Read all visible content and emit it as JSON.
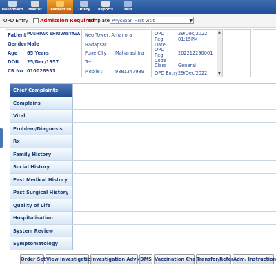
{
  "toolbar": {
    "items": [
      {
        "label": "Dashboard",
        "icon": "dashboard-icon"
      },
      {
        "label": "Master",
        "icon": "master-icon"
      },
      {
        "label": "Transaction",
        "icon": "transaction-icon"
      },
      {
        "label": "Utility",
        "icon": "utility-icon"
      },
      {
        "label": "Reports",
        "icon": "reports-icon"
      },
      {
        "label": "Help",
        "icon": "help-icon"
      }
    ],
    "active": "Transaction"
  },
  "entry": {
    "title": "OPD Entry",
    "admission_label": "Admission Required",
    "template_label": "Template:",
    "template_value": "Physician First Visit"
  },
  "patient": {
    "name_label": "Patient",
    "name_value": "PUSHPAK SHRIVASTAVA",
    "gender_label": "Gender",
    "gender_value": "Male",
    "age_label": "Age",
    "age_value": "65 Years",
    "dob_label": "DOB",
    "dob_value": "25/Dec/1957",
    "crno_label": "CR No",
    "crno_value": "010028931"
  },
  "address": {
    "line1": "Neo Tower, Amanora",
    "line2": "Hadapsar",
    "city_label": "Pune City",
    "state": "Maharashtra",
    "tel_label": "Tel :",
    "mobile_label": "Mobile :",
    "mobile_value": "9881347989"
  },
  "opd": {
    "reg_date_label": "OPD Reg. Date",
    "reg_date_value": "29/Dec/2022",
    "reg_time_value": "01:15PM",
    "reg_code_label": "OPD Reg. Code",
    "reg_code_value": "202212290001",
    "class_label": "Class",
    "class_value": "General",
    "entry_label": "OPD Entry",
    "entry_value": "29/Dec/2022"
  },
  "sections": [
    "Chief Complaints",
    "Complains",
    "Vital",
    "Problem/Diagnosis",
    "Rx",
    "Family History",
    "Social History",
    "Past Medical History",
    "Past Surgical History",
    "Quality of Life",
    "Hospitalisation",
    "System Review",
    "Symptomatology"
  ],
  "active_section": "Chief Complaints",
  "buttons": [
    "Order Set",
    "View Investigation",
    "Investigation Advice",
    "DMS",
    "Vaccination Chart",
    "Transfer/Refer",
    "Adm. Instruction"
  ],
  "colors": {
    "toolbar": "#1f4f97",
    "active_tab": "#e0801f",
    "accent_red": "#d40000",
    "section_active": "#244e92"
  }
}
